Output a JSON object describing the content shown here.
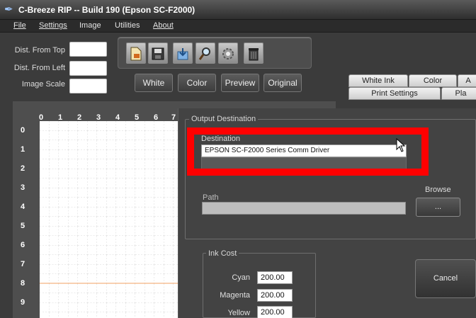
{
  "window": {
    "title": "C-Breeze RIP -- Build 190 (Epson SC-F2000)",
    "app_icon": "quill-icon"
  },
  "menu": [
    {
      "label": "File",
      "underline": true
    },
    {
      "label": "Settings",
      "underline": true
    },
    {
      "label": "Image",
      "underline": false
    },
    {
      "label": "Utilities",
      "underline": false
    },
    {
      "label": "About",
      "underline": true
    }
  ],
  "position": {
    "dist_top_label": "Dist. From Top",
    "dist_left_label": "Dist. From Left",
    "image_scale_label": "Image Scale",
    "dist_top_value": "",
    "dist_left_value": "",
    "image_scale_value": ""
  },
  "toolbar": {
    "tools": [
      "new-document-icon",
      "save-icon",
      "download-icon",
      "search-icon",
      "gear-icon",
      "trash-icon"
    ]
  },
  "view_buttons": [
    "White",
    "Color",
    "Preview",
    "Original"
  ],
  "tabs": {
    "row1": [
      "White Ink",
      "Color",
      "A"
    ],
    "row2": [
      "Print Settings",
      "Pla"
    ]
  },
  "ruler": {
    "x_ticks": [
      "0",
      "1",
      "2",
      "3",
      "4",
      "5",
      "6",
      "7"
    ],
    "y_ticks": [
      "0",
      "1",
      "2",
      "3",
      "4",
      "5",
      "6",
      "7",
      "8",
      "9"
    ]
  },
  "output_destination": {
    "group_title": "Output Destination",
    "destination_label": "Destination",
    "destination_value": "EPSON SC-F2000 Series Comm Driver",
    "path_label": "Path",
    "path_value": "",
    "browse_label": "Browse",
    "browse_button": "..."
  },
  "ink_cost": {
    "group_title": "Ink Cost",
    "rows": [
      {
        "label": "Cyan",
        "value": "200.00"
      },
      {
        "label": "Magenta",
        "value": "200.00"
      },
      {
        "label": "Yellow",
        "value": "200.00"
      }
    ]
  },
  "cancel_label": "Cancel",
  "colors": {
    "highlight": "#ff0000",
    "guide_line": "#f0a060",
    "background": "#3b3b3b"
  }
}
